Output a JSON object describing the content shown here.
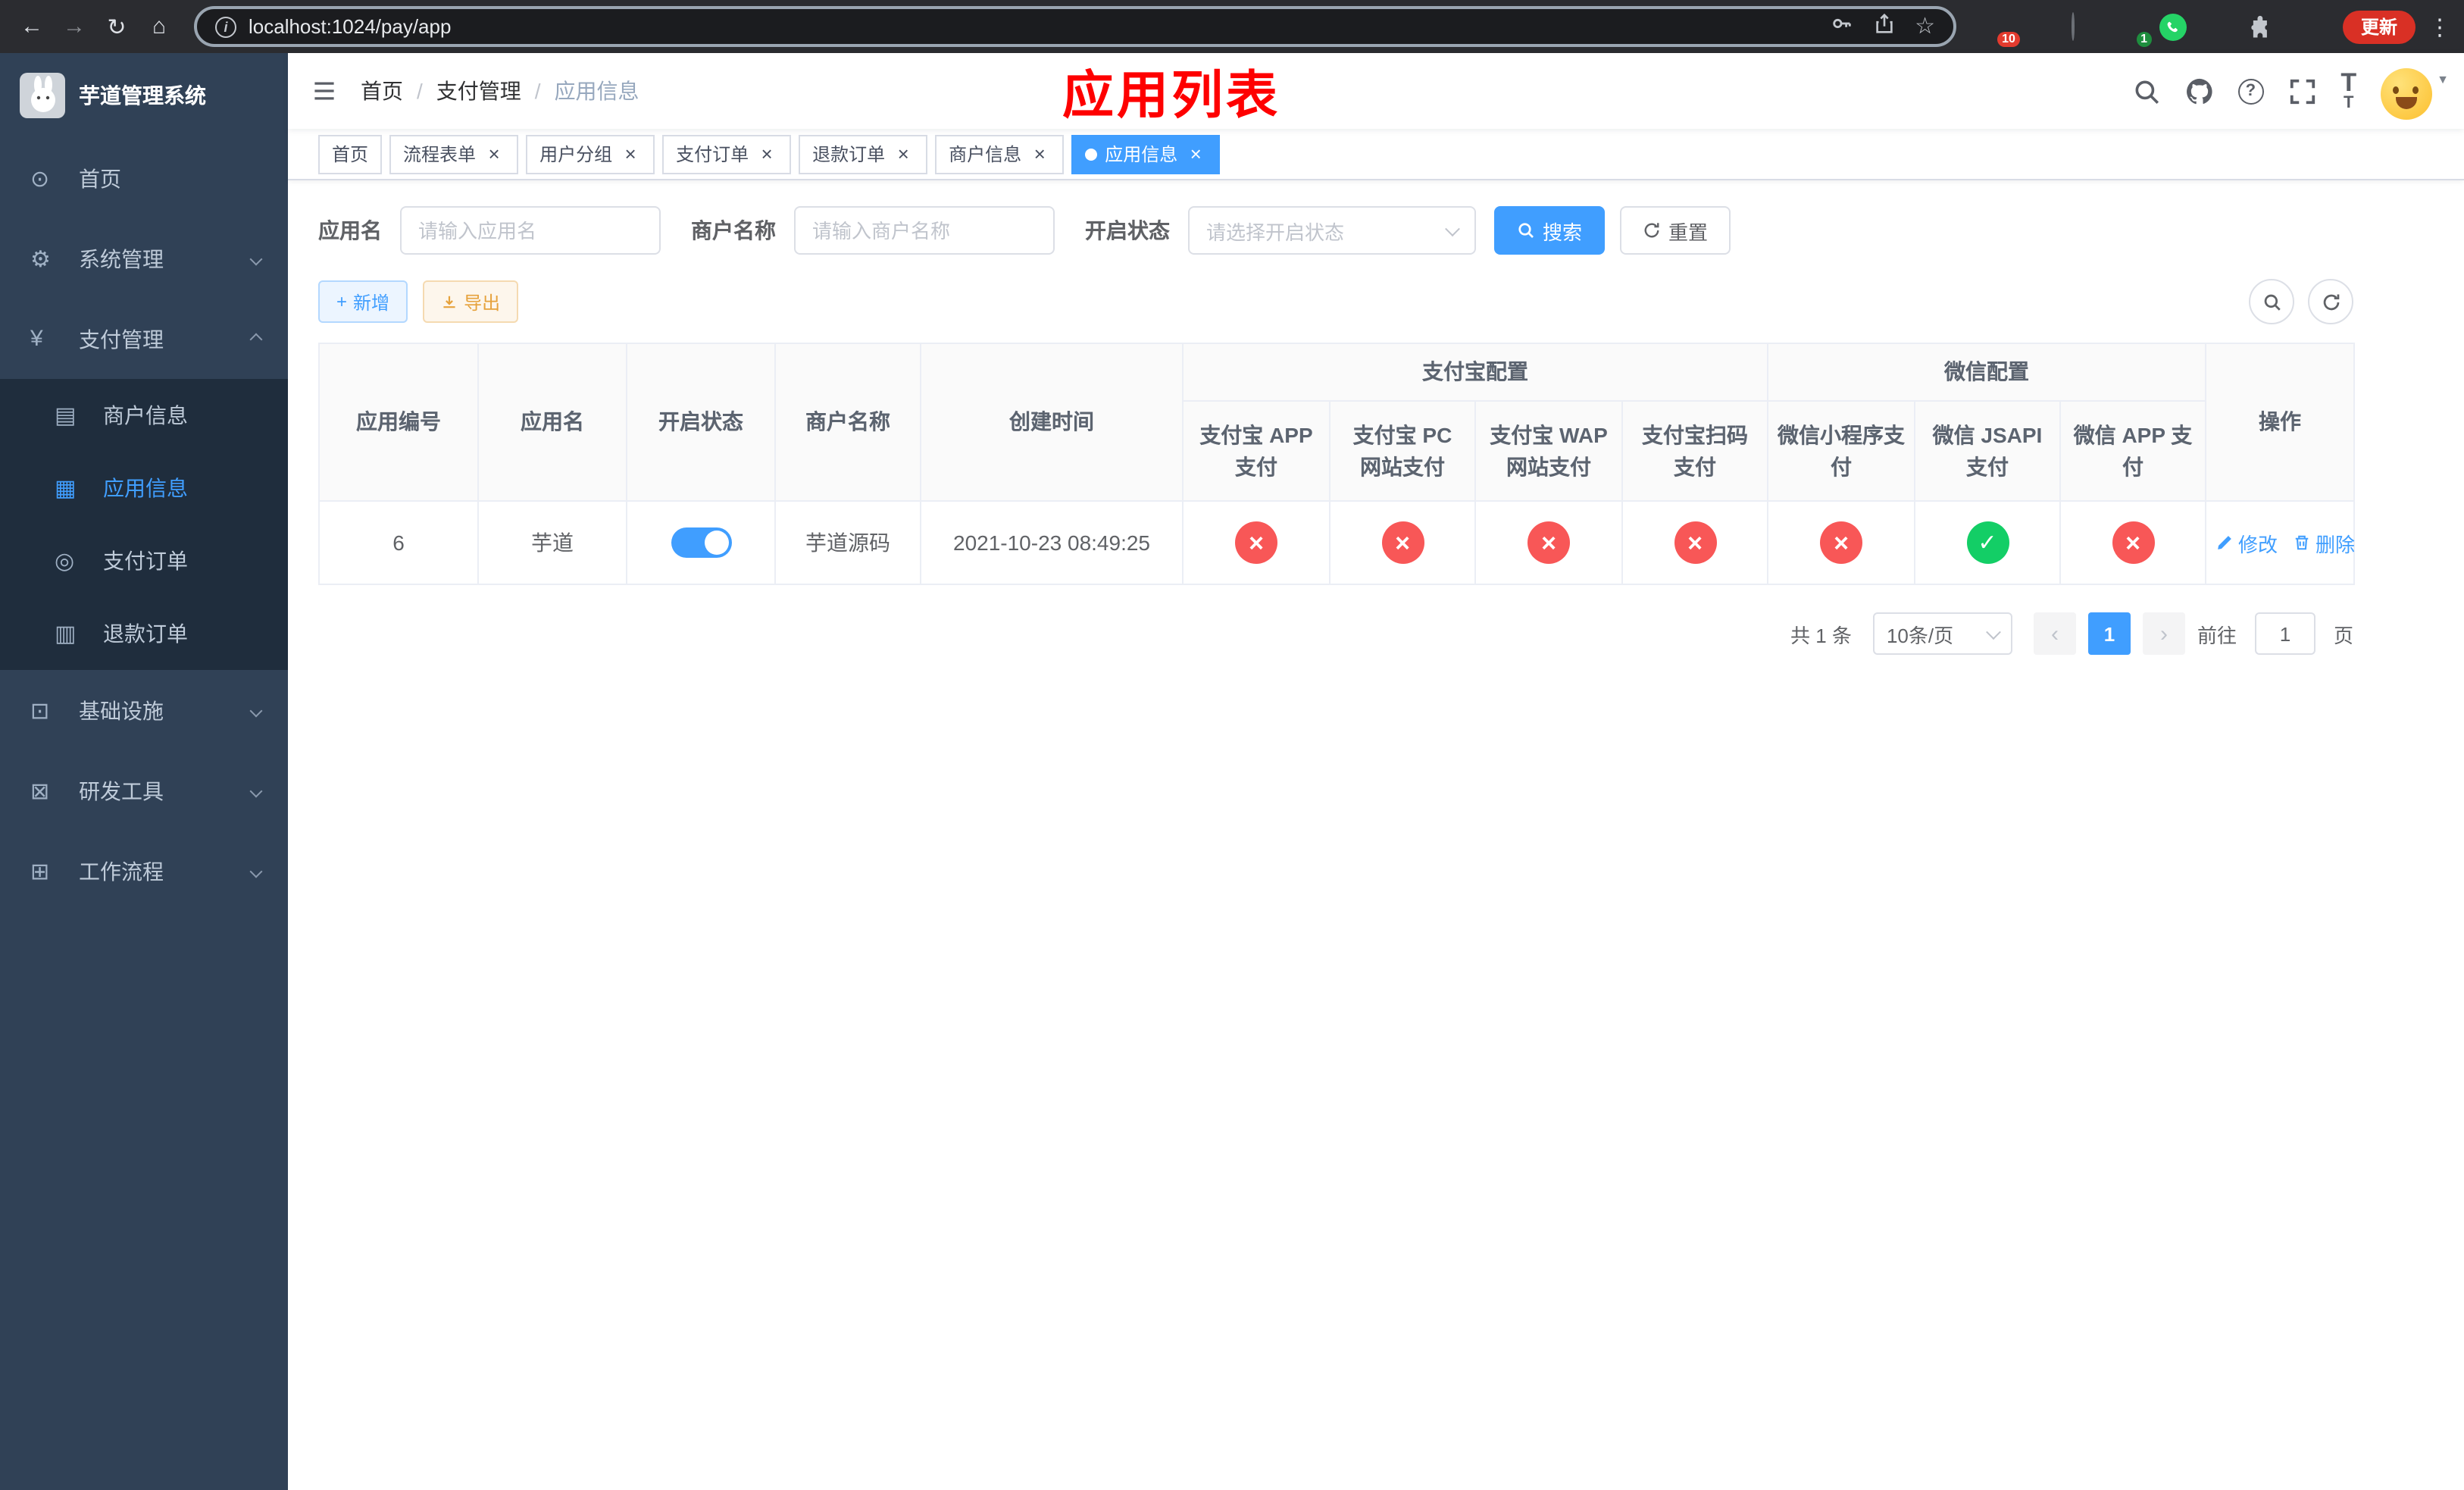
{
  "colors": {
    "primary": "#409eff",
    "success": "#13ce66",
    "danger": "#f85757",
    "sidebar_bg": "#304156",
    "submenu_bg": "#1f2d3d",
    "annotation_red": "#fe0000"
  },
  "icons": {
    "back": "←",
    "forward": "→",
    "reload": "↻",
    "home": "⌂",
    "more": "⋮",
    "star": "☆",
    "info": "i",
    "dashboard": "⊙",
    "system": "⚙",
    "payment": "¥",
    "merchant": "▤",
    "app": "▦",
    "pay_order": "◎",
    "refund_order": "▥",
    "infra": "⊡",
    "devtools": "⊠",
    "workflow": "⊞",
    "plus": "+",
    "close": "×",
    "prev": "‹",
    "next": "›",
    "caret": "▼",
    "question": "?",
    "text_large": "T",
    "text_small": "T"
  },
  "browser": {
    "url": "localhost:1024/pay/app",
    "update_label": "更新",
    "ext_badge_colorful": "10",
    "ext_badge_teal": "1"
  },
  "sidebar": {
    "logo_title": "芋道管理系统",
    "items": [
      {
        "label": "首页"
      },
      {
        "label": "系统管理"
      },
      {
        "label": "支付管理"
      },
      {
        "label": "基础设施"
      },
      {
        "label": "研发工具"
      },
      {
        "label": "工作流程"
      }
    ],
    "payment_children": [
      {
        "label": "商户信息"
      },
      {
        "label": "应用信息"
      },
      {
        "label": "支付订单"
      },
      {
        "label": "退款订单"
      }
    ]
  },
  "navbar": {
    "breadcrumb": [
      "首页",
      "支付管理",
      "应用信息"
    ],
    "annotation": "应用列表"
  },
  "tabs": [
    {
      "label": "首页"
    },
    {
      "label": "流程表单"
    },
    {
      "label": "用户分组"
    },
    {
      "label": "支付订单"
    },
    {
      "label": "退款订单"
    },
    {
      "label": "商户信息"
    },
    {
      "label": "应用信息"
    }
  ],
  "filters": {
    "app_name_label": "应用名",
    "app_name_placeholder": "请输入应用名",
    "merchant_label": "商户名称",
    "merchant_placeholder": "请输入商户名称",
    "status_label": "开启状态",
    "status_placeholder": "请选择开启状态",
    "search_label": "搜索",
    "reset_label": "重置"
  },
  "toolbar": {
    "add_label": "新增",
    "export_label": "导出"
  },
  "table": {
    "groups": {
      "alipay": "支付宝配置",
      "wechat": "微信配置"
    },
    "columns": {
      "id": "应用编号",
      "name": "应用名",
      "status": "开启状态",
      "merchant": "商户名称",
      "created": "创建时间",
      "alipay_app": "支付宝 APP 支付",
      "alipay_pc": "支付宝 PC 网站支付",
      "alipay_wap": "支付宝 WAP 网站支付",
      "alipay_scan": "支付宝扫码支付",
      "wx_lite": "微信小程序支付",
      "wx_jsapi": "微信 JSAPI 支付",
      "wx_app": "微信 APP 支付",
      "actions": "操作"
    },
    "rows": [
      {
        "id": "6",
        "name": "芋道",
        "enabled_class": "on",
        "merchant": "芋道源码",
        "created": "2021-10-23 08:49:25",
        "alipay_app": "fail",
        "alipay_pc": "fail",
        "alipay_wap": "fail",
        "alipay_scan": "fail",
        "wx_lite": "fail",
        "wx_jsapi": "ok",
        "wx_app": "fail",
        "edit_label": "修改",
        "delete_label": "删除"
      }
    ]
  },
  "pagination": {
    "total": "共 1 条",
    "page_size": "10条/页",
    "current_page": "1",
    "goto_label": "前往",
    "goto_value": "1",
    "page_unit": "页"
  }
}
